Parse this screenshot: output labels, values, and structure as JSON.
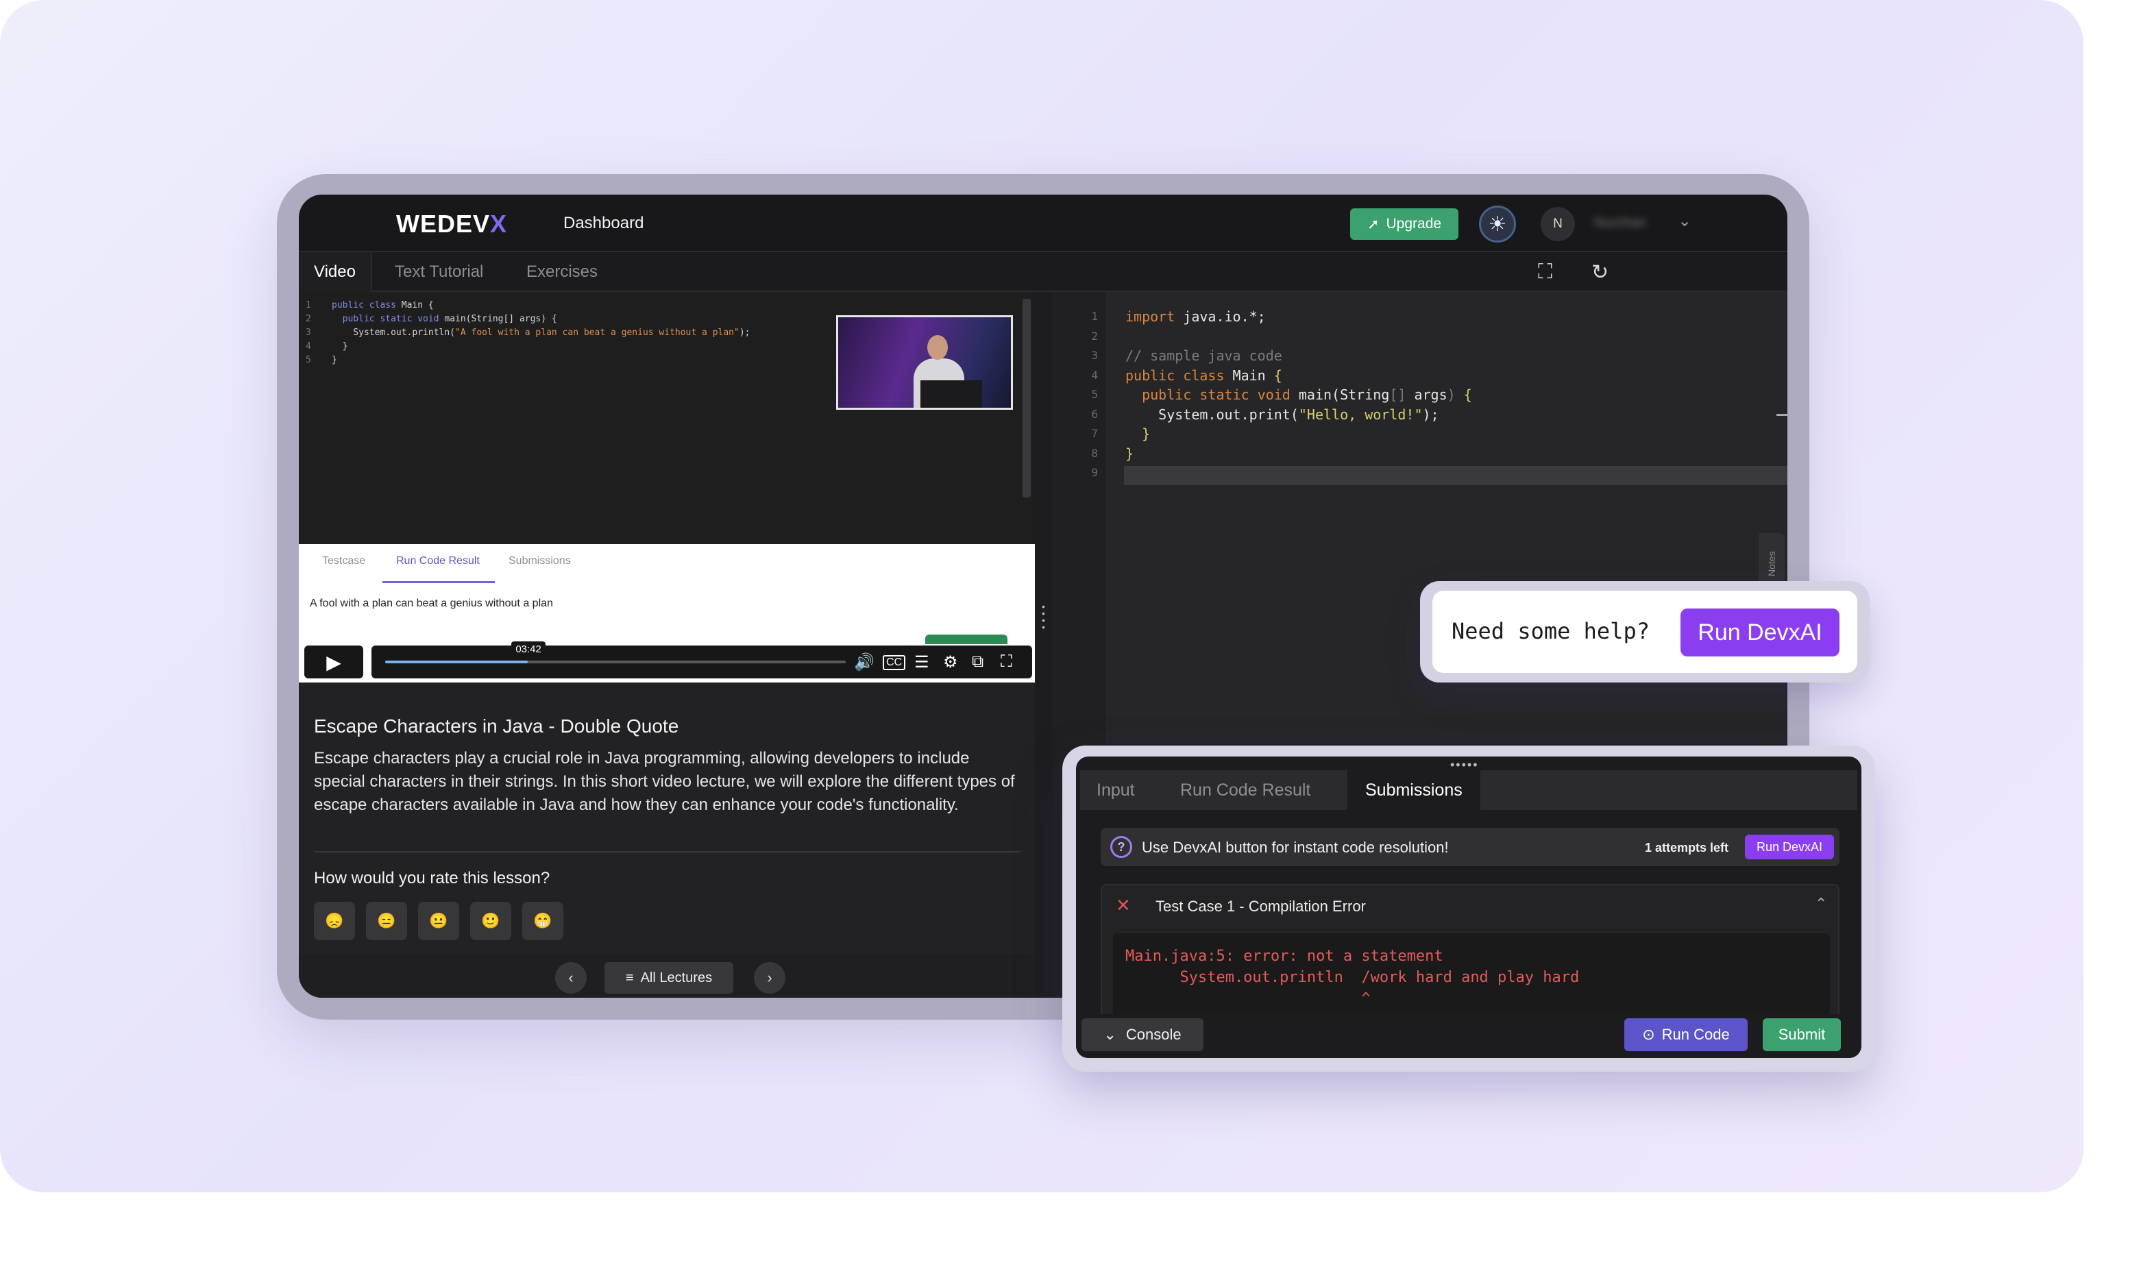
{
  "header": {
    "logo_main": "WEDEV",
    "logo_x": "X",
    "nav_title": "Dashboard",
    "upgrade_label": "Upgrade",
    "avatar_initial": "N",
    "username": "Nurzhan"
  },
  "tabs": [
    "Video",
    "Text Tutorial",
    "Exercises"
  ],
  "video": {
    "mini_code": [
      {
        "n": "1",
        "text": "public class Main {"
      },
      {
        "n": "2",
        "text": "  public static void main(String[] args) {"
      },
      {
        "n": "3",
        "text": "    System.out.println(\"A fool with a plan can beat a genius without a plan\");"
      },
      {
        "n": "4",
        "text": "  }"
      },
      {
        "n": "5",
        "text": "}"
      }
    ],
    "inner_tabs": [
      "Testcase",
      "Run Code Result",
      "Submissions"
    ],
    "output": "A fool with a plan can beat a genius without a plan",
    "time": "03:42",
    "progress": 0.31
  },
  "lesson": {
    "title": "Escape Characters in Java - Double Quote",
    "description": "Escape characters play a crucial role in Java programming, allowing developers to include special characters in their strings. In this short video lecture, we will explore the different types of escape characters available in Java and how they can enhance your code's functionality.",
    "rate_question": "How would you rate this lesson?",
    "emojis": [
      "😞",
      "😑",
      "😐",
      "🙂",
      "😁"
    ]
  },
  "lecture_nav": {
    "all_label": "All Lectures"
  },
  "editor": {
    "lines": [
      {
        "n": "1",
        "parts": [
          {
            "c": "k2",
            "t": "import"
          },
          {
            "c": "",
            "t": " java.io.*;"
          }
        ]
      },
      {
        "n": "2",
        "parts": []
      },
      {
        "n": "3",
        "parts": [
          {
            "c": "cm",
            "t": "// sample java code"
          }
        ]
      },
      {
        "n": "4",
        "parts": [
          {
            "c": "k2",
            "t": "public class"
          },
          {
            "c": "",
            "t": " Main "
          },
          {
            "c": "s2",
            "t": "{"
          }
        ]
      },
      {
        "n": "5",
        "parts": [
          {
            "c": "",
            "t": "  "
          },
          {
            "c": "k2",
            "t": "public static void"
          },
          {
            "c": "",
            "t": " main(String"
          },
          {
            "c": "cm",
            "t": "[]"
          },
          {
            "c": "",
            "t": " args"
          },
          {
            "c": "cm",
            "t": ")"
          },
          {
            "c": "s2",
            "t": " {"
          }
        ]
      },
      {
        "n": "6",
        "parts": [
          {
            "c": "",
            "t": "    System.out.print("
          },
          {
            "c": "s2",
            "t": "\"Hello, world!\""
          },
          {
            "c": "",
            "t": ");"
          }
        ]
      },
      {
        "n": "7",
        "parts": [
          {
            "c": "",
            "t": "  "
          },
          {
            "c": "s2",
            "t": "}"
          }
        ]
      },
      {
        "n": "8",
        "parts": [
          {
            "c": "s2",
            "t": "}"
          }
        ]
      },
      {
        "n": "9",
        "parts": []
      }
    ],
    "notes_label": "Notes"
  },
  "help": {
    "text": "Need some help?",
    "button": "Run DevxAI"
  },
  "console": {
    "tabs": [
      "Input",
      "Run Code Result",
      "Submissions"
    ],
    "info": "Use DevxAI button for instant code resolution!",
    "attempts": "1 attempts left",
    "run_devxai": "Run DevxAI",
    "testcase_title": "Test Case 1 - Compilation Error",
    "error_lines": [
      "Main.java:5: error: not a statement",
      "      System.out.println  /work hard and play hard",
      "                          ^"
    ],
    "console_label": "Console",
    "run_code": "Run Code",
    "submit": "Submit"
  },
  "colors": {
    "accent_purple": "#8a3ef0",
    "accent_indigo": "#5b55c9",
    "accent_green": "#3ba16f",
    "error_red": "#e45a5a"
  }
}
